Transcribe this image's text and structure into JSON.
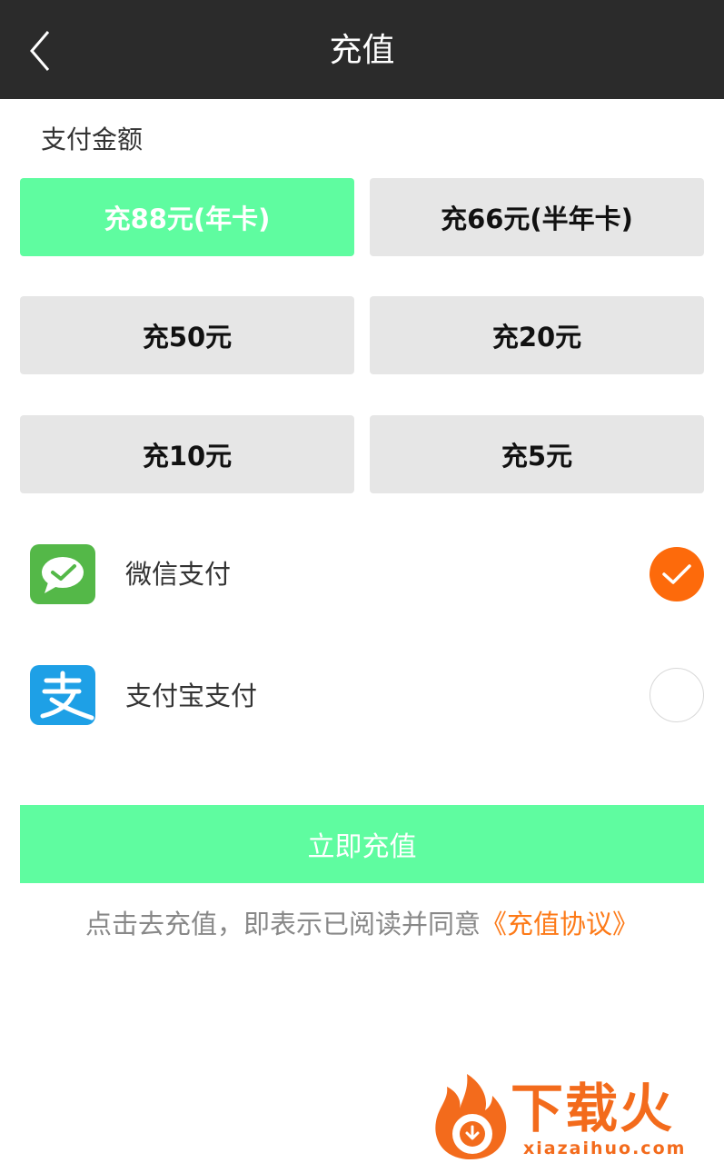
{
  "header": {
    "title": "充值"
  },
  "amount": {
    "label": "支付金额",
    "options": [
      {
        "label": "充88元(年卡)",
        "selected": true
      },
      {
        "label": "充66元(半年卡)",
        "selected": false
      },
      {
        "label": "充50元",
        "selected": false
      },
      {
        "label": "充20元",
        "selected": false
      },
      {
        "label": "充10元",
        "selected": false
      },
      {
        "label": "充5元",
        "selected": false
      }
    ]
  },
  "payment": {
    "methods": [
      {
        "label": "微信支付",
        "icon": "wechat-pay-icon",
        "checked": true
      },
      {
        "label": "支付宝支付",
        "icon": "alipay-icon",
        "checked": false
      }
    ]
  },
  "submit": {
    "label": "立即充值"
  },
  "agreement": {
    "text": "点击去充值，即表示已阅读并同意",
    "link": "《充值协议》"
  },
  "watermark": {
    "cn": "下载火",
    "en": "xiazaihuo.com"
  },
  "colors": {
    "accent_green": "#5ffca0",
    "accent_orange": "#fd6a0b",
    "header_bg": "#2b2b2b"
  }
}
